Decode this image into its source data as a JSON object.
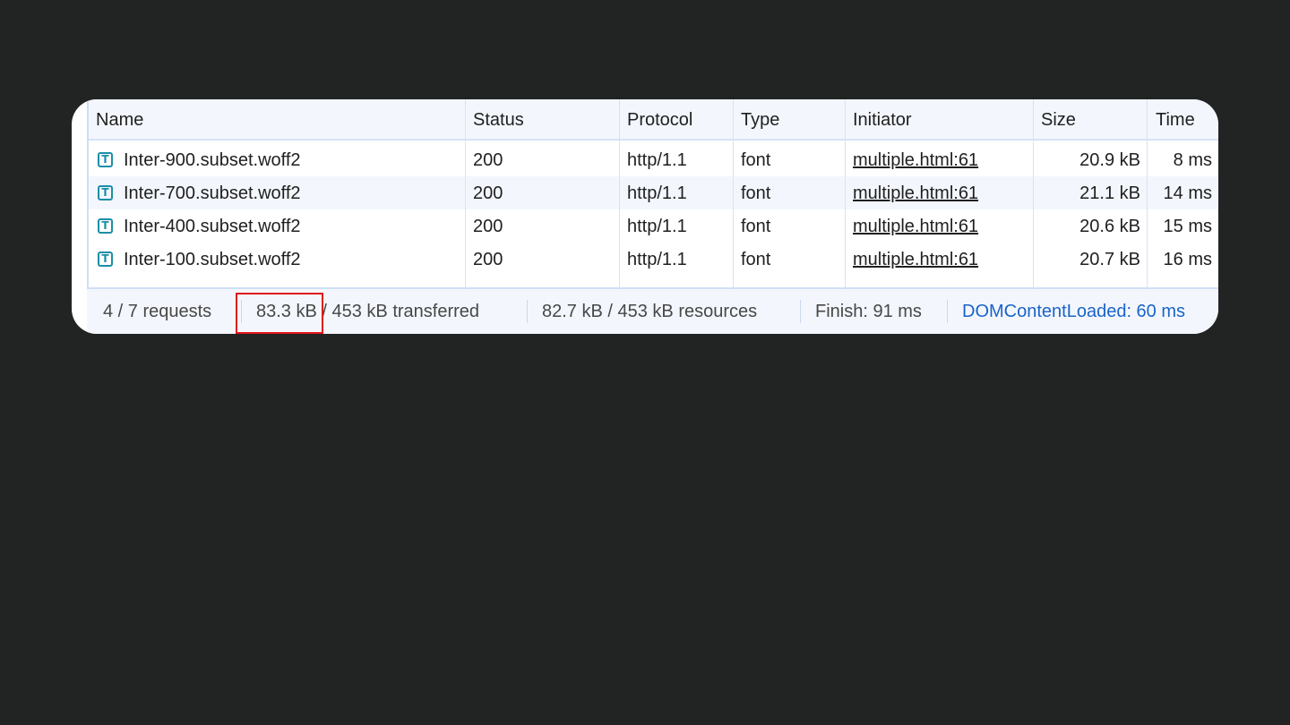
{
  "columns": {
    "name": "Name",
    "status": "Status",
    "protocol": "Protocol",
    "type": "Type",
    "initiator": "Initiator",
    "size": "Size",
    "time": "Time"
  },
  "rows": [
    {
      "name": "Inter-900.subset.woff2",
      "status": "200",
      "protocol": "http/1.1",
      "type": "font",
      "initiator": "multiple.html:61",
      "size": "20.9 kB",
      "time": "8 ms"
    },
    {
      "name": "Inter-700.subset.woff2",
      "status": "200",
      "protocol": "http/1.1",
      "type": "font",
      "initiator": "multiple.html:61",
      "size": "21.1 kB",
      "time": "14 ms"
    },
    {
      "name": "Inter-400.subset.woff2",
      "status": "200",
      "protocol": "http/1.1",
      "type": "font",
      "initiator": "multiple.html:61",
      "size": "20.6 kB",
      "time": "15 ms"
    },
    {
      "name": "Inter-100.subset.woff2",
      "status": "200",
      "protocol": "http/1.1",
      "type": "font",
      "initiator": "multiple.html:61",
      "size": "20.7 kB",
      "time": "16 ms"
    }
  ],
  "row_icon": {
    "glyph": "T",
    "name": "font-file-icon"
  },
  "footer": {
    "requests": "4 / 7 requests",
    "transferred": "83.3 kB / 453 kB transferred",
    "resources": "82.7 kB / 453 kB resources",
    "finish": "Finish: 91 ms",
    "dom_content_loaded": "DOMContentLoaded: 60 ms"
  },
  "colors": {
    "background": "#222423",
    "header_bg": "#f3f7fd",
    "icon": "#1a8fa8",
    "dom_loaded": "#1a63c9",
    "highlight": "#e0161b"
  }
}
